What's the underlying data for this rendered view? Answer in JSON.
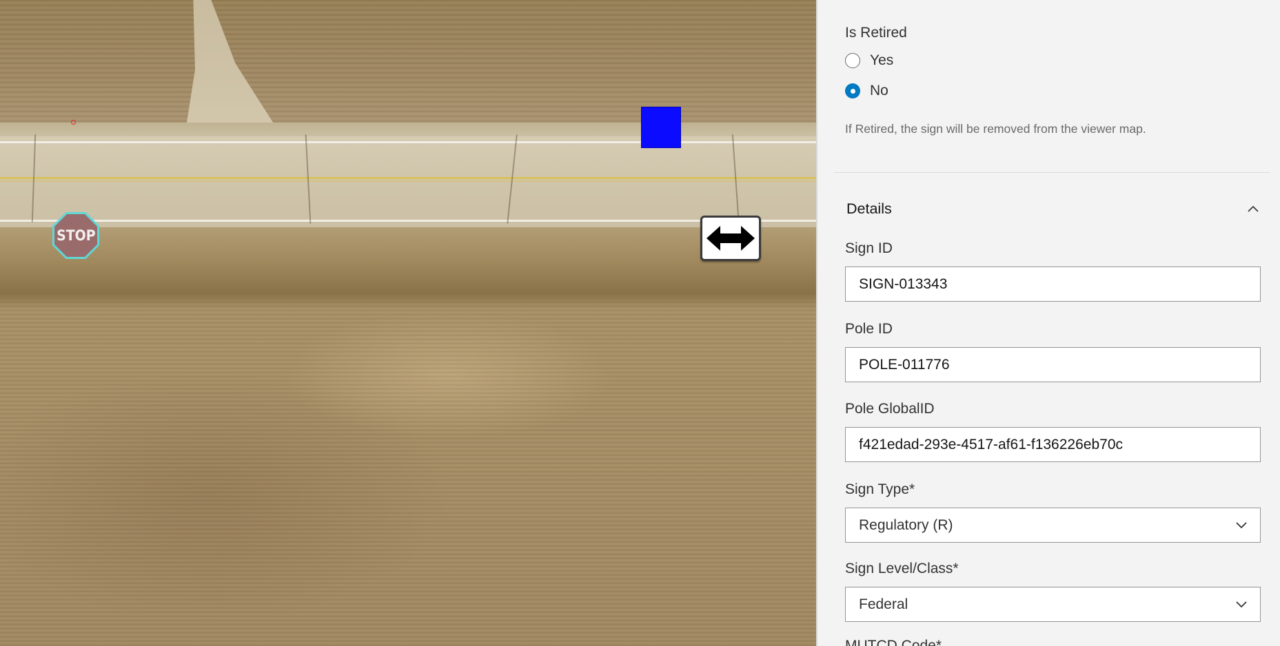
{
  "map": {
    "stop_sign_label": "STOP",
    "symbols": [
      "stop-sign",
      "blue-square-marker",
      "two-direction-arrow-sign"
    ]
  },
  "panel": {
    "is_retired": {
      "label": "Is Retired",
      "options": [
        {
          "label": "Yes",
          "checked": false
        },
        {
          "label": "No",
          "checked": true
        }
      ],
      "help_text": "If Retired, the sign will be removed from the viewer map."
    },
    "details": {
      "title": "Details",
      "expanded": true,
      "sign_id": {
        "label": "Sign ID",
        "value": "SIGN-013343"
      },
      "pole_id": {
        "label": "Pole ID",
        "value": "POLE-011776"
      },
      "pole_global_id": {
        "label": "Pole GlobalID",
        "value": "f421edad-293e-4517-af61-f136226eb70c"
      },
      "sign_type": {
        "label": "Sign Type*",
        "value": "Regulatory (R)"
      },
      "sign_level_class": {
        "label": "Sign Level/Class*",
        "value": "Federal"
      },
      "mutcd_code": {
        "label": "MUTCD Code*"
      }
    }
  },
  "colors": {
    "accent": "#007ac2",
    "marker_blue": "#0b0bff",
    "stop_fill": "#9a6b6b",
    "stop_outline": "#5fd7d7"
  }
}
